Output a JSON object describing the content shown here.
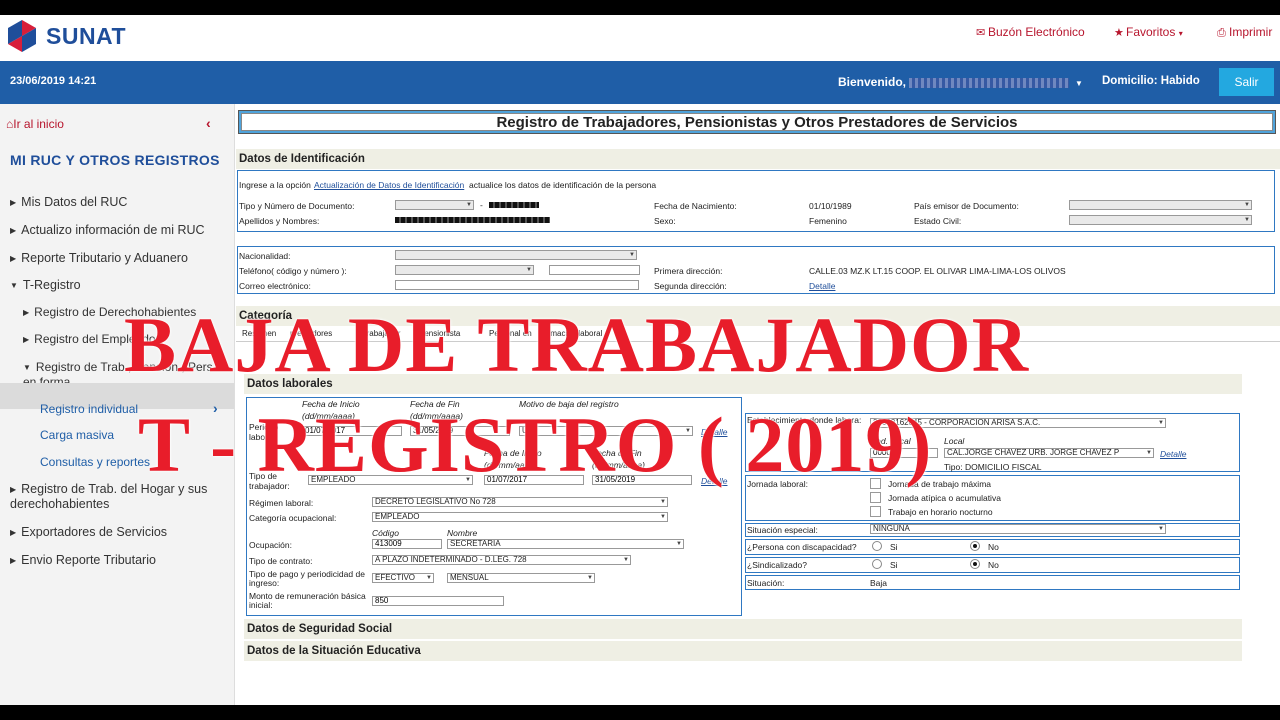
{
  "header": {
    "logo_text": "SUNAT",
    "links": [
      {
        "label": "Buzón Electrónico",
        "icon": "mail-icon"
      },
      {
        "label": "Favoritos",
        "icon": "star-icon"
      },
      {
        "label": "Imprimir",
        "icon": "printer-icon"
      }
    ]
  },
  "bar": {
    "datetime": "23/06/2019 14:21",
    "welcome": "Bienvenido,",
    "domicilio": "Domicilio: Habido",
    "salir": "Salir"
  },
  "sidebar": {
    "home": "Ir al inicio",
    "title": "MI RUC Y OTROS REGISTROS",
    "items": [
      "Mis Datos del RUC",
      "Actualizo información de mi RUC",
      "Reporte Tributario y Aduanero",
      "T-Registro",
      "Registro de Derechohabientes",
      "Registro del Empleador",
      "Registro de Trab., Pension., Pers. en forma",
      "Registro individual",
      "Carga masiva",
      "Consultas y reportes",
      "Registro de Trab. del Hogar y sus derechohabientes",
      "Exportadores de Servicios",
      "Envio Reporte Tributario"
    ]
  },
  "main": {
    "title": "Registro de Trabajadores, Pensionistas y Otros Prestadores de Servicios",
    "ident": {
      "section": "Datos de Identificación",
      "intro_pre": "Ingrese a la opción",
      "intro_link": "Actualización de Datos de Identificación",
      "intro_post": "actualice los datos de identificación de la persona",
      "tipo_doc": "Tipo y Número de Documento:",
      "dash": "-",
      "apellidos": "Apellidos y Nombres:",
      "fecha_nac": "Fecha de Nacimiento:",
      "fecha_nac_val": "01/10/1989",
      "sexo": "Sexo:",
      "sexo_val": "Femenino",
      "pais": "País emisor de Documento:",
      "estado_civil": "Estado Civil:",
      "nacionalidad": "Nacionalidad:",
      "telefono": "Teléfono( código y número ):",
      "correo": "Correo electrónico:",
      "primera_dir": "Primera dirección:",
      "primera_dir_val": "CALLE.03 MZ.K LT.15 COOP. EL OLIVAR LIMA-LIMA-LOS OLIVOS",
      "segunda_dir": "Segunda dirección:",
      "detalle": "Detalle"
    },
    "categoria": {
      "section": "Categoría",
      "tabs": [
        "Resumen",
        "prestadores",
        "Trabajador",
        "Pensionista",
        "Personal en",
        "formación laboral"
      ]
    },
    "laborales": {
      "section": "Datos laborales",
      "fecha_inicio": "Fecha de Inicio",
      "fecha_fin": "Fecha de Fin",
      "formato": "(dd/mm/aaaa)",
      "motivo": "Motivo de baja del registro",
      "periodo": "Periodo laboral",
      "periodo_inicio": "01/07/2017",
      "periodo_fin": "31/05/2019",
      "motivo_val": "U",
      "tipo_trab": "Tipo de trabajador:",
      "tipo_trab_val": "EMPLEADO",
      "tipo_trab_inicio": "01/07/2017",
      "tipo_trab_fin": "31/05/2019",
      "detalle": "Detalle",
      "regimen": "Régimen laboral:",
      "regimen_val": "DECRETO LEGISLATIVO No 728",
      "categoria_ocup": "Categoría ocupacional:",
      "categoria_ocup_val": "EMPLEADO",
      "codigo": "Código",
      "nombre": "Nombre",
      "ocupacion": "Ocupación:",
      "ocupacion_cod": "413009",
      "ocupacion_nom": "SECRETARIA",
      "tipo_contrato": "Tipo de contrato:",
      "tipo_contrato_val": "A PLAZO INDETERMINADO - D.LEG. 728",
      "tipo_pago": "Tipo de pago y periodicidad de ingreso:",
      "tipo_pago_val": "EFECTIVO",
      "periodicidad_val": "MENSUAL",
      "monto": "Monto de remuneración básica inicial:",
      "monto_val": "850",
      "establecimiento": "Establecimiento donde labora:",
      "establecimiento_val": "20602162045 - CORPORACION ARISA S.A.C.",
      "cod_local": "Cod. Local",
      "local": "Local",
      "cod_local_val": "0000",
      "local_val": "CAL.JORGE CHAVEZ URB. JORGE CHAVEZ P",
      "tipo_local": "Tipo: DOMICILIO FISCAL",
      "jornada": "Jornada laboral:",
      "jornada_opts": [
        "Jornada de trabajo máxima",
        "Jornada atípica o acumulativa",
        "Trabajo en horario nocturno"
      ],
      "situacion_esp": "Situación especial:",
      "situacion_esp_val": "NINGUNA",
      "discapacidad": "¿Persona con discapacidad?",
      "sindicalizado": "¿Sindicalizado?",
      "si": "Si",
      "no": "No",
      "situacion": "Situación:",
      "situacion_val": "Baja"
    },
    "seguridad": "Datos de Seguridad Social",
    "educativa": "Datos de la Situación Educativa"
  },
  "overlay": {
    "line1": "BAJA DE TRABAJADOR",
    "line2": "T - REGISTRO ( 2019)"
  },
  "colors": {
    "brand_blue": "#1f5ea7",
    "accent_red": "#b7152d",
    "overlay_red": "#e81d2a",
    "salir": "#23a8e0"
  }
}
